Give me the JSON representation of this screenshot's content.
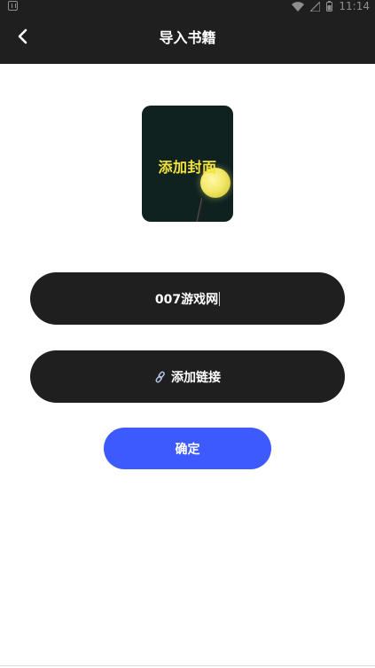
{
  "status_bar": {
    "time": "11:14",
    "icons": [
      "notification-icon",
      "wifi-icon",
      "signal-icon",
      "battery-icon"
    ]
  },
  "app_bar": {
    "title": "导入书籍",
    "back_icon": "chevron-left-icon"
  },
  "cover": {
    "label": "添加封面"
  },
  "form": {
    "book_name": "007游戏网",
    "link_label": "添加链接",
    "link_icon": "link-icon",
    "confirm_label": "确定"
  },
  "colors": {
    "bar_bg": "#1f1f1f",
    "pill_bg": "#1f1f1f",
    "accent": "#3d5afe",
    "cover_bg": "#0f2220",
    "cover_text": "#f2e23a"
  }
}
